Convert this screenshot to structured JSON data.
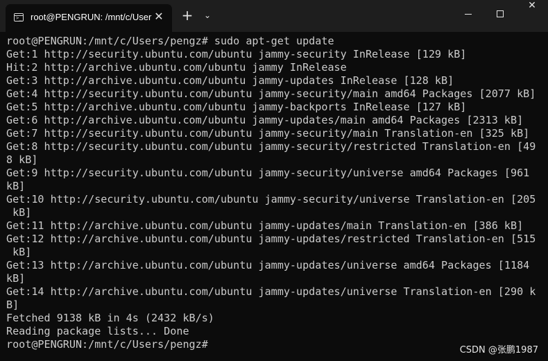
{
  "tab": {
    "title": "root@PENGRUN: /mnt/c/User",
    "icon": "terminal-icon",
    "icon_glyph": ">_",
    "close": "✕"
  },
  "toolbar": {
    "new_tab": "+",
    "dropdown": "⌄"
  },
  "window_controls": {
    "close": "✕"
  },
  "terminal": {
    "lines": [
      "root@PENGRUN:/mnt/c/Users/pengz# sudo apt-get update",
      "Get:1 http://security.ubuntu.com/ubuntu jammy-security InRelease [129 kB]",
      "Hit:2 http://archive.ubuntu.com/ubuntu jammy InRelease",
      "Get:3 http://archive.ubuntu.com/ubuntu jammy-updates InRelease [128 kB]",
      "Get:4 http://security.ubuntu.com/ubuntu jammy-security/main amd64 Packages [2077 kB]",
      "Get:5 http://archive.ubuntu.com/ubuntu jammy-backports InRelease [127 kB]",
      "Get:6 http://archive.ubuntu.com/ubuntu jammy-updates/main amd64 Packages [2313 kB]",
      "Get:7 http://security.ubuntu.com/ubuntu jammy-security/main Translation-en [325 kB]",
      "Get:8 http://security.ubuntu.com/ubuntu jammy-security/restricted Translation-en [49",
      "8 kB]",
      "Get:9 http://security.ubuntu.com/ubuntu jammy-security/universe amd64 Packages [961",
      "kB]",
      "Get:10 http://security.ubuntu.com/ubuntu jammy-security/universe Translation-en [205",
      " kB]",
      "Get:11 http://archive.ubuntu.com/ubuntu jammy-updates/main Translation-en [386 kB]",
      "Get:12 http://archive.ubuntu.com/ubuntu jammy-updates/restricted Translation-en [515",
      " kB]",
      "Get:13 http://archive.ubuntu.com/ubuntu jammy-updates/universe amd64 Packages [1184",
      "kB]",
      "Get:14 http://archive.ubuntu.com/ubuntu jammy-updates/universe Translation-en [290 k",
      "B]",
      "Fetched 9138 kB in 4s (2432 kB/s)",
      "Reading package lists... Done",
      "root@PENGRUN:/mnt/c/Users/pengz#"
    ]
  },
  "watermark": "CSDN @张鹏1987",
  "colors": {
    "background": "#0c0c0c",
    "titlebar": "#1e1e1e",
    "text": "#cccccc"
  }
}
